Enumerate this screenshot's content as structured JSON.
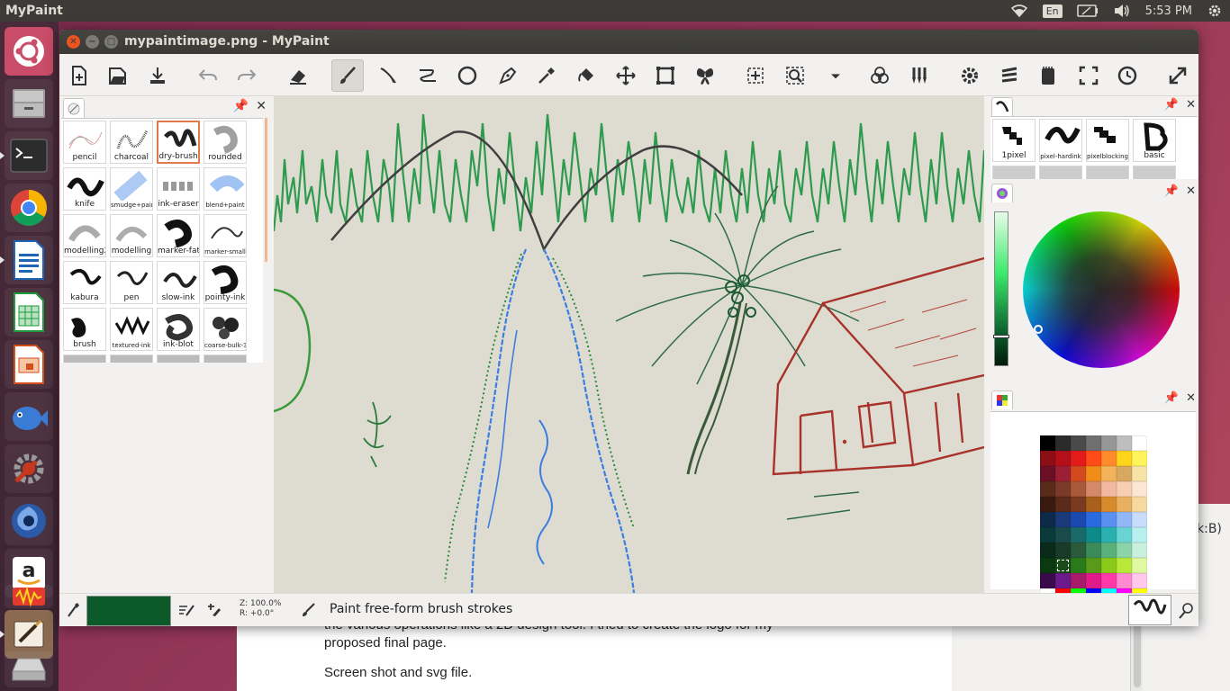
{
  "top_panel": {
    "app_name": "MyPaint",
    "keyboard_layout": "En",
    "clock": "5:53 PM",
    "icons": [
      "wifi-icon",
      "keyboard-icon",
      "battery-icon",
      "volume-icon",
      "settings-gear-icon"
    ]
  },
  "launcher": {
    "items": [
      {
        "name": "ubuntu-dash-icon",
        "color": "#e95420"
      },
      {
        "name": "files-icon",
        "color": "#8a8a8a"
      },
      {
        "name": "terminal-icon",
        "color": "#2c2c2c"
      },
      {
        "name": "chrome-icon",
        "color": "#4285f4"
      },
      {
        "name": "writer-icon",
        "color": "#1c65b7"
      },
      {
        "name": "calc-icon",
        "color": "#1e9b3a"
      },
      {
        "name": "impress-icon",
        "color": "#d3501a"
      },
      {
        "name": "fish-app-icon",
        "color": "#3a7bd5"
      },
      {
        "name": "system-settings-icon",
        "color": "#c6381e"
      },
      {
        "name": "shutter-icon",
        "color": "#2b5aa8"
      },
      {
        "name": "amazon-icon",
        "color": "#f0a024"
      },
      {
        "name": "audio-app-icon",
        "color": "#e33b2f"
      },
      {
        "name": "mypaint-icon",
        "color": "#8a6b52"
      },
      {
        "name": "drive-icon",
        "color": "#b0b0b0"
      }
    ]
  },
  "background_doc": {
    "line1": "the various operations like a 2D design tool. I tried to create the logo for my",
    "line2": "proposed final page.",
    "line3": "Screen shot and svg file.",
    "side_text": "k:B)"
  },
  "window": {
    "title": "mypaintimage.png - MyPaint"
  },
  "toolbar": {
    "items": [
      "new-document-icon",
      "open-file-icon",
      "save-icon",
      "undo-icon",
      "redo-icon",
      "eraser-icon",
      "freehand-brush-icon",
      "ink-line-icon",
      "connected-lines-icon",
      "ellipse-icon",
      "inking-pen-icon",
      "color-picker-icon",
      "fill-icon",
      "move-layer-icon",
      "frame-icon",
      "symmetry-icon",
      "pan-icon",
      "zoom-icon",
      "dropdown-arrow-icon",
      "layers-icon",
      "brush-settings-icon",
      "preferences-icon",
      "menu-icon",
      "scratchpad-icon",
      "fullscreen-icon",
      "history-icon",
      "expand-icon"
    ]
  },
  "brushes_left": [
    {
      "label": "pencil"
    },
    {
      "label": "charcoal"
    },
    {
      "label": "dry-brush"
    },
    {
      "label": "rounded"
    },
    {
      "label": "knife"
    },
    {
      "label": "smudge+paint"
    },
    {
      "label": "ink-eraser"
    },
    {
      "label": "blend+paint"
    },
    {
      "label": "modelling2"
    },
    {
      "label": "modelling"
    },
    {
      "label": "marker-fat"
    },
    {
      "label": "marker-small"
    },
    {
      "label": "kabura"
    },
    {
      "label": "pen"
    },
    {
      "label": "slow-ink"
    },
    {
      "label": "pointy-ink"
    },
    {
      "label": "brush"
    },
    {
      "label": "textured-ink"
    },
    {
      "label": "ink-blot"
    },
    {
      "label": "coarse-bulk-3"
    }
  ],
  "brushes_right": [
    {
      "label": "1pixel"
    },
    {
      "label": "pixel-hardink"
    },
    {
      "label": "pixelblocking"
    },
    {
      "label": "basic"
    }
  ],
  "palette": {
    "rows": [
      [
        "#000000",
        "#2b2b2b",
        "#4a4a4a",
        "#6f6f6f",
        "#969696",
        "#bebebe",
        "#ffffff"
      ],
      [
        "#8b0f14",
        "#b3101a",
        "#e31b1b",
        "#ff4a1a",
        "#ff8a2a",
        "#ffd41a",
        "#fff55a"
      ],
      [
        "#6a0f25",
        "#9b1f35",
        "#d24a1e",
        "#f08c1a",
        "#f2b35a",
        "#d8a860",
        "#f7e3a8"
      ],
      [
        "#5a2a1a",
        "#7a3a2a",
        "#a85a3a",
        "#d48a6a",
        "#f2b8a0",
        "#f7cfb0",
        "#fde7d4"
      ],
      [
        "#3a1a10",
        "#5a2a1a",
        "#7a3a20",
        "#a8601a",
        "#d68a2a",
        "#e8b060",
        "#f6d9a0"
      ],
      [
        "#0e2a4a",
        "#1a3a7a",
        "#1a4ab0",
        "#2a6ae0",
        "#5a90f0",
        "#90b8f8",
        "#c8dcfc"
      ],
      [
        "#0a3a3a",
        "#1a4a4a",
        "#1a6a6a",
        "#0f8a8a",
        "#2ab0b0",
        "#6ad4d4",
        "#b8f0f0"
      ],
      [
        "#0a2a1a",
        "#1a3a2a",
        "#2a5a3a",
        "#3a8a5a",
        "#5ab07a",
        "#8ad4a8",
        "#c8f0dc"
      ],
      [
        "#0a3a10",
        "#1a4a1a",
        "#2a7a1a",
        "#5a9a1a",
        "#8ac81a",
        "#b8e83a",
        "#e0f8a0"
      ],
      [
        "#3a0a4a",
        "#6a1a8a",
        "#a81a6a",
        "#e01a8a",
        "#ff3aa8",
        "#ff8ad0",
        "#ffc8ec"
      ],
      [
        "#ffffff",
        "#ff0000",
        "#00ff00",
        "#0000ff",
        "#00ffff",
        "#ff00ff",
        "#ffff00"
      ]
    ]
  },
  "status": {
    "current_color": "#0c5a2a",
    "zoom": "Z: 100.0%",
    "rotation": "R: +0.0°",
    "message": "Paint free-form brush strokes"
  }
}
